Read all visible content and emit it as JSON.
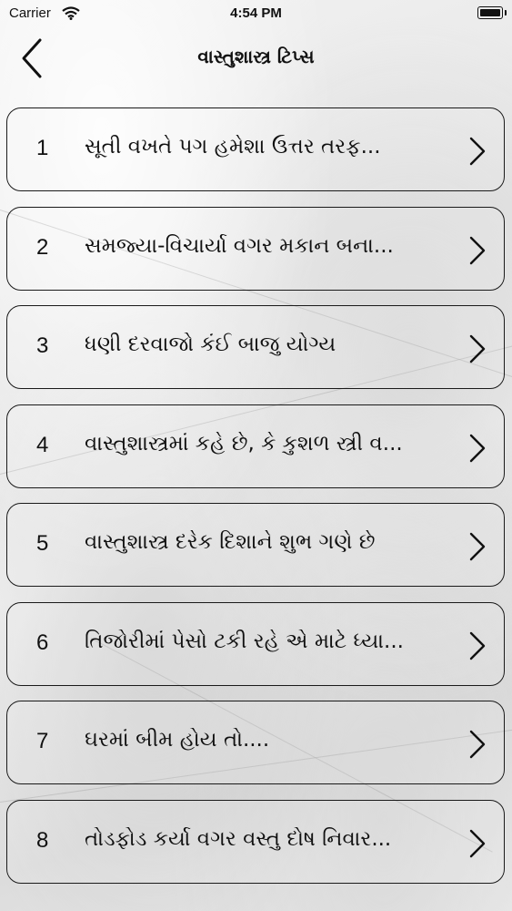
{
  "status_bar": {
    "carrier": "Carrier",
    "time": "4:54 PM",
    "icons": [
      "wifi-icon",
      "battery-icon"
    ]
  },
  "nav": {
    "title": "વાસ્તુશાસ્ત્ર ટિપ્સ",
    "back_icon": "chevron-left-icon"
  },
  "list": {
    "chevron_icon": "chevron-right-icon",
    "items": [
      {
        "number": "1",
        "title": "સૂતી વખતે પગ હમેશા ઉત્તર તરફ..."
      },
      {
        "number": "2",
        "title": "સમજ્યા-વિચાર્યા વગર મકાન બના..."
      },
      {
        "number": "3",
        "title": "ધણી દરવાજો કંઈ બાજુ યોગ્ય"
      },
      {
        "number": "4",
        "title": "વાસ્તુશાસ્ત્રમાં કહે છે, કે કુશળ સ્ત્રી વ..."
      },
      {
        "number": "5",
        "title": "વાસ્તુશાસ્ત્ર દરેક દિશાને શુભ ગણે છે"
      },
      {
        "number": "6",
        "title": "તિજોરીમાં પેસો ટકી રહે એ માટે ધ્યા..."
      },
      {
        "number": "7",
        "title": "ઘરમાં બીમ હોય તો...."
      },
      {
        "number": "8",
        "title": "તોડફોડ કર્યા વગર વસ્તુ દોષ નિવાર..."
      }
    ]
  }
}
